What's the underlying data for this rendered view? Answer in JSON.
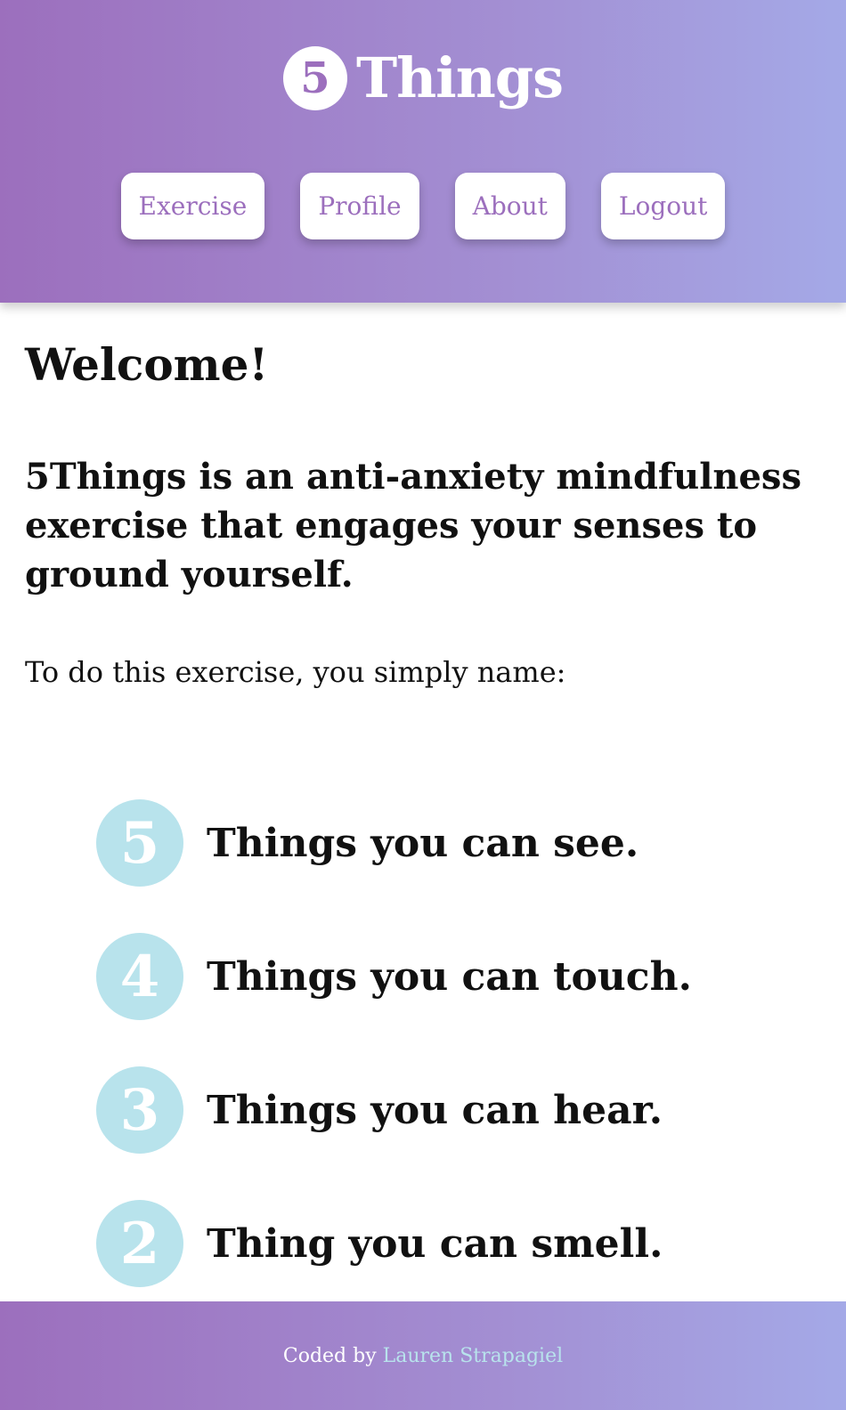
{
  "colors": {
    "brand_purple": "#9c6fbd",
    "brand_lavender": "#a4a9e7",
    "step_circle": "#b8e3ec",
    "link_color": "#b8e3ec"
  },
  "header": {
    "logo_number": "5",
    "logo_text": "Things",
    "nav": [
      {
        "label": "Exercise"
      },
      {
        "label": "Profile"
      },
      {
        "label": "About"
      },
      {
        "label": "Logout"
      }
    ]
  },
  "main": {
    "welcome": "Welcome!",
    "intro": "5Things is an anti-anxiety mindfulness exercise that engages your senses to ground yourself.",
    "instruction": "To do this exercise, you simply name:",
    "steps": [
      {
        "number": "5",
        "text": "Things you can see."
      },
      {
        "number": "4",
        "text": "Things you can touch."
      },
      {
        "number": "3",
        "text": "Things you can hear."
      },
      {
        "number": "2",
        "text": "Thing you can smell."
      }
    ]
  },
  "footer": {
    "prefix": "Coded by ",
    "author": "Lauren Strapagiel"
  }
}
